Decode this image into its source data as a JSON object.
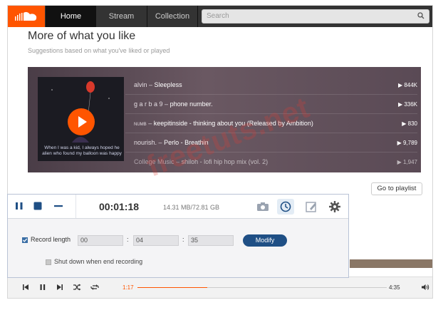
{
  "nav": {
    "home": "Home",
    "stream": "Stream",
    "collection": "Collection"
  },
  "search": {
    "placeholder": "Search"
  },
  "section": {
    "title": "More of what you like",
    "subtitle": "Suggestions based on what you've liked or played"
  },
  "artwork": {
    "caption": "When I was a kid, I always hoped he alien who found my balloon was happy"
  },
  "tracks": [
    {
      "artist": "alvin",
      "title": "Sleepless",
      "plays": "844K"
    },
    {
      "artist": "g a r b a 9",
      "title": "phone number.",
      "plays": "336K"
    },
    {
      "artist": "numb",
      "title": "keepitinside - thinking about you (Released by Ambition)",
      "plays": "830"
    },
    {
      "artist": "nourish.",
      "title": "Perlo - Breathin",
      "plays": "9,789"
    },
    {
      "artist": "College Music",
      "title": "shiloh - lofi hip hop mix (vol. 2)",
      "plays": "1,947"
    }
  ],
  "playlist_button": "Go to playlist",
  "watermark": "freetuts.net",
  "recorder": {
    "elapsed": "00:01:18",
    "size": "14.31 MB/72.81 GB",
    "record_length_label": "Record length",
    "hours": "00",
    "minutes": "04",
    "seconds": "35",
    "modify_label": "Modify",
    "shutdown_label": "Shut down when end recording"
  },
  "player": {
    "elapsed": "1:17",
    "total": "4:35",
    "progress": 0.28
  },
  "colors": {
    "accent": "#ff5500",
    "topbar": "#333333",
    "modify": "#1f4f85"
  }
}
